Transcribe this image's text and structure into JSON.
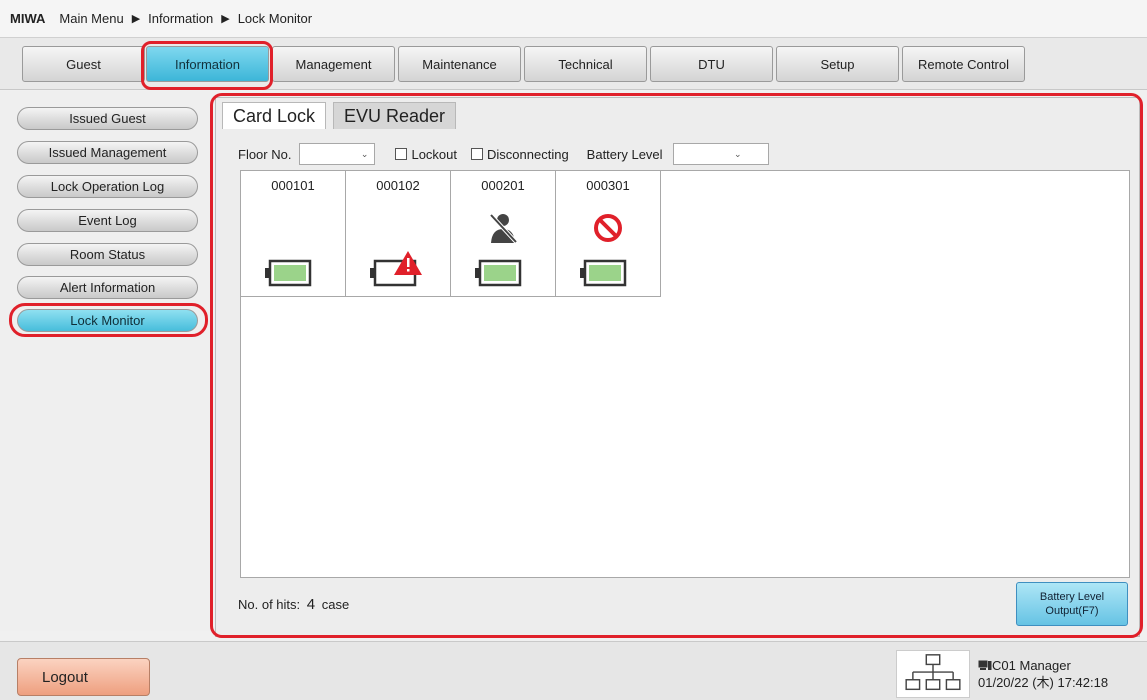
{
  "breadcrumb": {
    "brand": "MIWA",
    "items": [
      "Main Menu",
      "Information",
      "Lock Monitor"
    ]
  },
  "top_tabs": [
    {
      "label": "Guest",
      "active": false
    },
    {
      "label": "Information",
      "active": true
    },
    {
      "label": "Management",
      "active": false
    },
    {
      "label": "Maintenance",
      "active": false
    },
    {
      "label": "Technical",
      "active": false
    },
    {
      "label": "DTU",
      "active": false
    },
    {
      "label": "Setup",
      "active": false
    },
    {
      "label": "Remote Control",
      "active": false
    }
  ],
  "sidebar": {
    "items": [
      {
        "label": "Issued Guest",
        "active": false
      },
      {
        "label": "Issued Management",
        "active": false
      },
      {
        "label": "Lock Operation Log",
        "active": false
      },
      {
        "label": "Event Log",
        "active": false
      },
      {
        "label": "Room Status",
        "active": false
      },
      {
        "label": "Alert Information",
        "active": false
      },
      {
        "label": "Lock Monitor",
        "active": true
      }
    ]
  },
  "panel": {
    "tabs": [
      {
        "label": "Card Lock",
        "active": true
      },
      {
        "label": "EVU Reader",
        "active": false
      }
    ],
    "filters": {
      "floor_label": "Floor No.",
      "floor_value": "",
      "lockout_label": "Lockout",
      "lockout_checked": false,
      "disconnecting_label": "Disconnecting",
      "disconnecting_checked": false,
      "battery_label": "Battery Level",
      "battery_value": ""
    },
    "locks": [
      {
        "number": "000101",
        "status_icon": "",
        "battery": "normal-battery-icon"
      },
      {
        "number": "000102",
        "status_icon": "",
        "battery": "low-battery-warning-icon"
      },
      {
        "number": "000201",
        "status_icon": "disconnected-person-icon",
        "battery": "normal-battery-icon"
      },
      {
        "number": "000301",
        "status_icon": "lockout-prohibited-icon",
        "battery": "normal-battery-icon"
      }
    ],
    "hits_label": "No. of hits:",
    "hits_count": "4",
    "hits_unit": "case",
    "battery_output_button": {
      "line1": "Battery Level",
      "line2": "Output(F7)"
    }
  },
  "footer": {
    "logout_label": "Logout",
    "terminal": "C01",
    "user": "Manager",
    "datetime": "01/20/22 (木) 17:42:18"
  },
  "colors": {
    "active_tab": "#3cb6d8",
    "highlight_ring": "#e0202a",
    "battery_fill": "#9bd38a",
    "warning": "#e0202a",
    "logout": "#ee9f7f"
  }
}
